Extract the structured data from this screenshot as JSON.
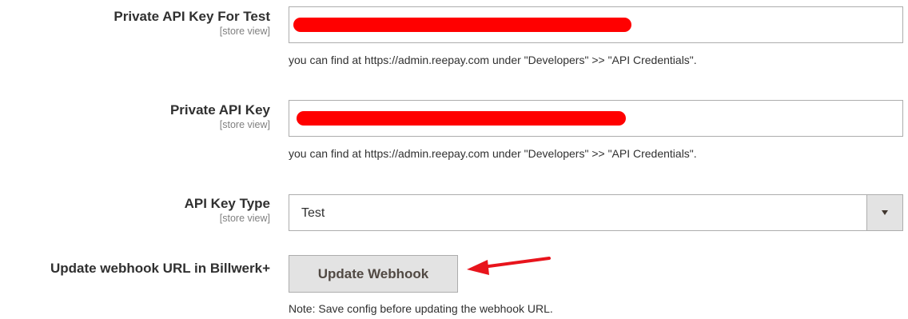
{
  "fields": {
    "private_key_test": {
      "label": "Private API Key For Test",
      "scope": "[store view]",
      "hint": "you can find at https://admin.reepay.com under \"Developers\" >> \"API Credentials\"."
    },
    "private_key": {
      "label": "Private API Key",
      "scope": "[store view]",
      "hint": "you can find at https://admin.reepay.com under \"Developers\" >> \"API Credentials\"."
    },
    "api_key_type": {
      "label": "API Key Type",
      "scope": "[store view]",
      "selected": "Test"
    },
    "webhook": {
      "label": "Update webhook URL in Billwerk+",
      "button_label": "Update Webhook",
      "note": "Note: Save config before updating the webhook URL."
    }
  },
  "colors": {
    "redaction": "#ff0000",
    "annotation_arrow": "#e8141c",
    "button_bg": "#e3e3e3",
    "border": "#adadad"
  }
}
